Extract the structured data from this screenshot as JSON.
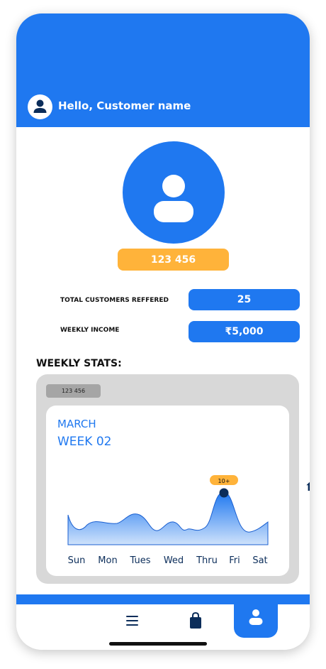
{
  "header": {
    "greeting": "Hello, Customer name"
  },
  "profile": {
    "id_badge": "123 456"
  },
  "stats": [
    {
      "label": "TOTAL CUSTOMERS REFFERED",
      "value": "25"
    },
    {
      "label": "WEEKLY INCOME",
      "value": "₹5,000"
    }
  ],
  "weekly": {
    "title": "WEEKLY STATS:",
    "tag": "123 456",
    "month": "MARCH",
    "week": "WEEK 02",
    "peak_label": "10+"
  },
  "chart_data": {
    "type": "area",
    "x": [
      "Sun",
      "Mon",
      "Tues",
      "Wed",
      "Thru",
      "Fri",
      "Sat"
    ],
    "callout": {
      "at": "Fri",
      "label": "10+"
    }
  },
  "nav": {
    "items": [
      {
        "name": "menu",
        "icon": "menu-icon"
      },
      {
        "name": "shop",
        "icon": "bag-icon"
      },
      {
        "name": "profile",
        "icon": "user-icon",
        "active": true
      }
    ]
  },
  "colors": {
    "primary": "#1f78f0",
    "accent": "#ffb33a",
    "dark": "#0b2d5a",
    "card_bg": "#d8d8d8"
  }
}
